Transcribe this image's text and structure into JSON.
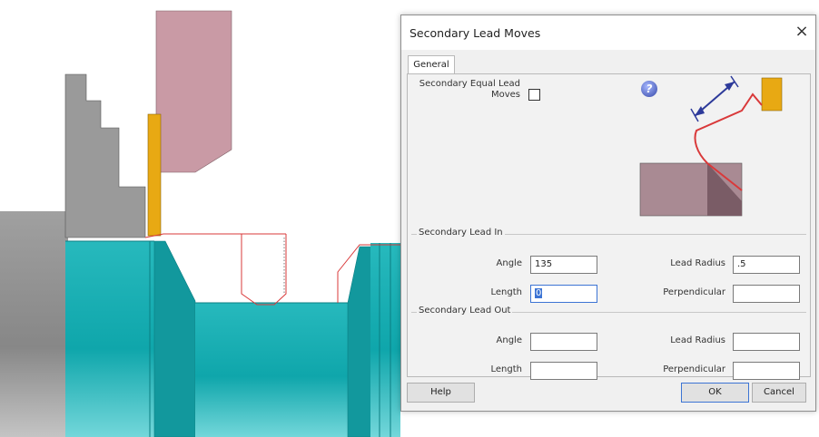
{
  "dialog": {
    "title": "Secondary Lead Moves",
    "close_glyph": "×",
    "tab_general": "General",
    "equal_lead_label_line1": "Secondary Equal Lead",
    "equal_lead_label_line2": "Moves",
    "help_glyph": "?",
    "lead_in": {
      "group_label": "Secondary Lead In",
      "angle_label": "Angle",
      "angle_value": "135",
      "length_label": "Length",
      "length_value": "0",
      "lead_radius_label": "Lead Radius",
      "lead_radius_value": ".5",
      "perpendicular_label": "Perpendicular",
      "perpendicular_value": ""
    },
    "lead_out": {
      "group_label": "Secondary Lead Out",
      "angle_label": "Angle",
      "angle_value": "",
      "length_label": "Length",
      "length_value": "",
      "lead_radius_label": "Lead Radius",
      "lead_radius_value": "",
      "perpendicular_label": "Perpendicular",
      "perpendicular_value": ""
    },
    "buttons": {
      "help": "Help",
      "ok": "OK",
      "cancel": "Cancel"
    }
  },
  "colors": {
    "part_teal": "#1fb3b8",
    "stock_gray": "#9b9b9b",
    "tool_pink": "#c99aa5",
    "insert_yellow": "#e8a913",
    "toolpath_red": "#d9393a",
    "focus_blue": "#3c74d4"
  }
}
